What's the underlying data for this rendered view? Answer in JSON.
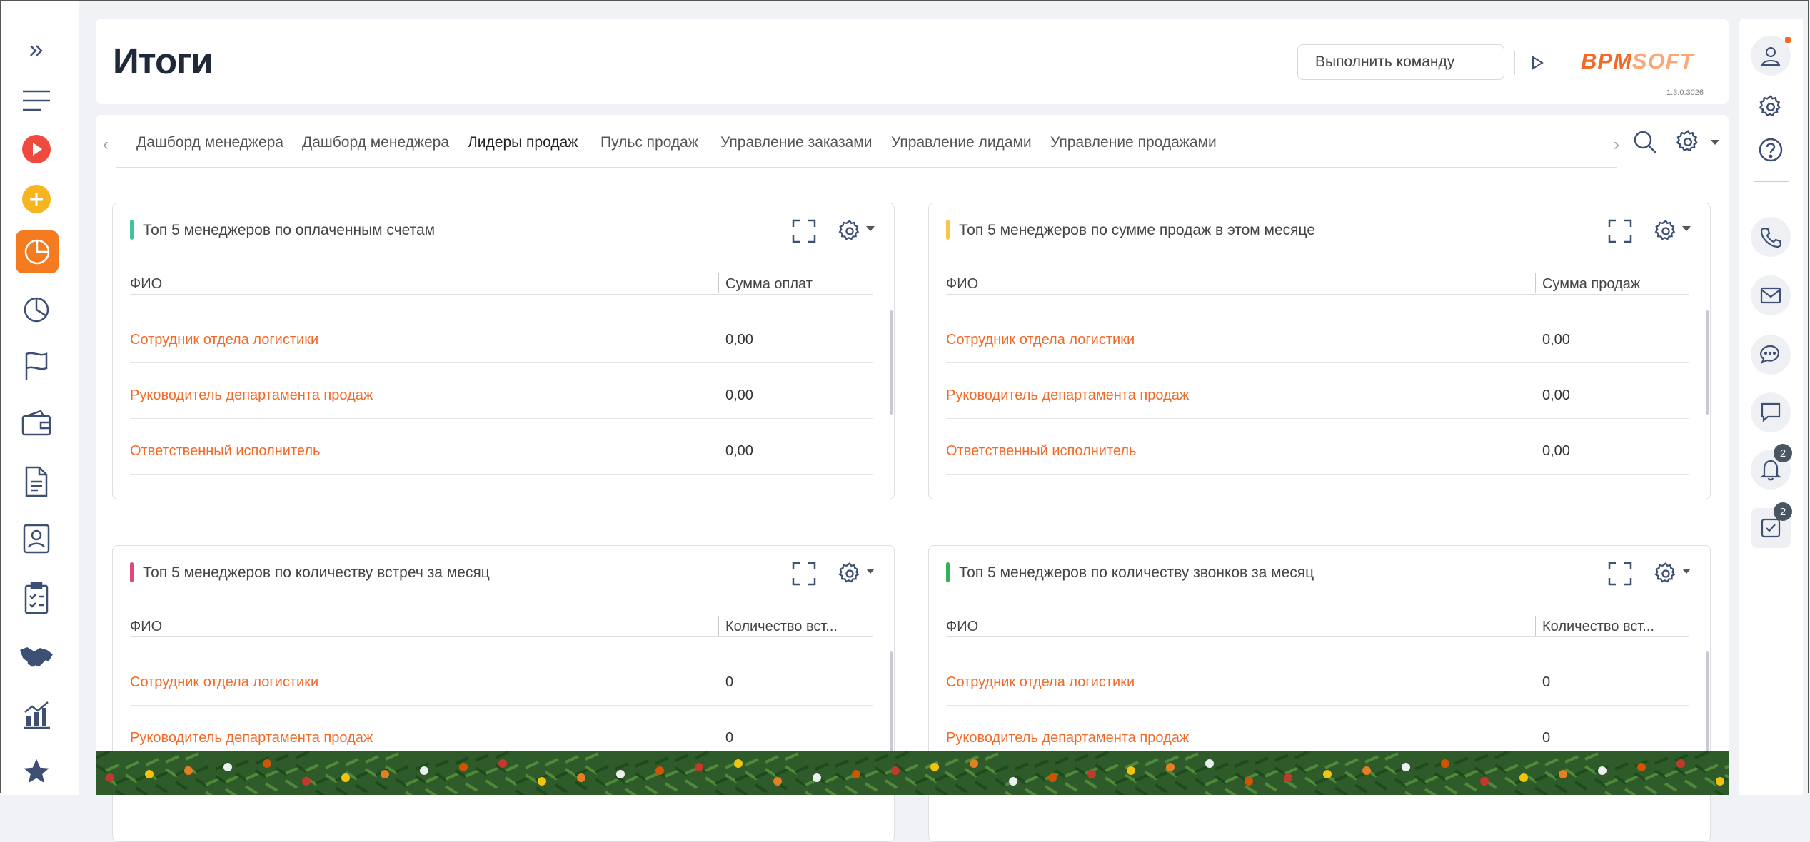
{
  "page_title": "Итоги",
  "command": {
    "placeholder": "Выполнить команду"
  },
  "brand": {
    "logo_a": "BPM",
    "logo_b": "SOFT",
    "version": "1.3.0.3026",
    "accent": "#f26a28"
  },
  "tabs": [
    "Дашборд менеджера",
    "Дашборд менеджера",
    "Лидеры продаж",
    "Пульс продаж",
    "Управление заказами",
    "Управление лидами",
    "Управление продажами"
  ],
  "active_tab": "Лидеры продаж",
  "widgets": [
    {
      "title": "Топ 5 менеджеров по оплаченным счетам",
      "marker_color": "#3fc2a0",
      "col_name": "ФИО",
      "col_value": "Сумма оплат",
      "rows": [
        {
          "name": "Сотрудник отдела логистики",
          "value": "0,00"
        },
        {
          "name": "Руководитель департамента продаж",
          "value": "0,00"
        },
        {
          "name": "Ответственный исполнитель",
          "value": "0,00"
        }
      ]
    },
    {
      "title": "Топ 5 менеджеров по сумме продаж в этом месяце",
      "marker_color": "#f7c548",
      "col_name": "ФИО",
      "col_value": "Сумма продаж",
      "rows": [
        {
          "name": "Сотрудник отдела логистики",
          "value": "0,00"
        },
        {
          "name": "Руководитель департамента продаж",
          "value": "0,00"
        },
        {
          "name": "Ответственный исполнитель",
          "value": "0,00"
        }
      ]
    },
    {
      "title": "Топ 5 менеджеров по количеству встреч за месяц",
      "marker_color": "#e0457b",
      "col_name": "ФИО",
      "col_value": "Количество вст...",
      "rows": [
        {
          "name": "Сотрудник отдела логистики",
          "value": "0"
        },
        {
          "name": "Руководитель департамента продаж",
          "value": "0"
        }
      ]
    },
    {
      "title": "Топ 5 менеджеров по количеству звонков за месяц",
      "marker_color": "#34b25a",
      "col_name": "ФИО",
      "col_value": "Количество вст...",
      "rows": [
        {
          "name": "Сотрудник отдела логистики",
          "value": "0"
        },
        {
          "name": "Руководитель департамента продаж",
          "value": "0"
        }
      ]
    }
  ],
  "right_bar": {
    "notifications_count": "2",
    "tasks_count": "2"
  },
  "left_bar_icons": [
    "expand-icon",
    "menu-icon",
    "play-icon",
    "add-icon",
    "dashboards-icon",
    "pie-chart-icon",
    "flag-icon",
    "wallet-icon",
    "document-icon",
    "contact-icon",
    "checklist-icon",
    "handshake-icon",
    "analytics-icon",
    "star-icon"
  ]
}
